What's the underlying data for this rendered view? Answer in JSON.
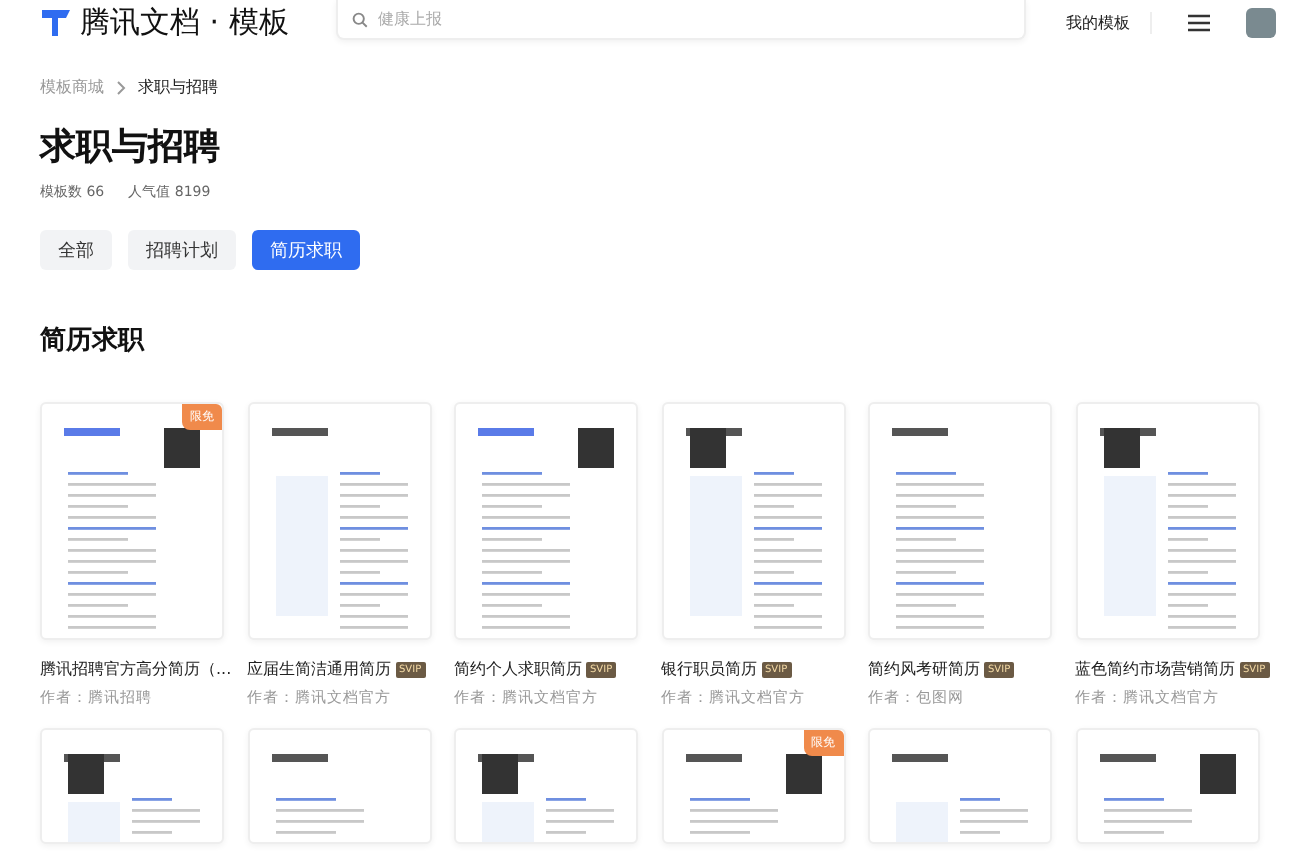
{
  "header": {
    "logo": "腾讯文档 · 模板",
    "search": {
      "placeholder": "健康上报"
    },
    "my_templates": "我的模板"
  },
  "breadcrumb": [
    {
      "label": "模板商城"
    },
    {
      "label": "求职与招聘"
    }
  ],
  "page": {
    "title": "求职与招聘",
    "stats": [
      "模板数 66",
      "人气值 8199"
    ]
  },
  "filters": [
    {
      "label": "全部",
      "selected": false
    },
    {
      "label": "招聘计划",
      "selected": false
    },
    {
      "label": "简历求职",
      "selected": true
    }
  ],
  "section": {
    "title": "简历求职"
  },
  "cards": [
    {
      "title": "腾讯招聘官方高分简历（...",
      "ribbon": "限免",
      "author": "作者：腾讯招聘"
    },
    {
      "title": "应届生简洁通用简历",
      "badge": "SVIP",
      "author": "作者：腾讯文档官方"
    },
    {
      "title": "简约个人求职简历",
      "badge": "SVIP",
      "author": "作者：腾讯文档官方"
    },
    {
      "title": "银行职员简历",
      "badge": "SVIP",
      "author": "作者：腾讯文档官方"
    },
    {
      "title": "简约风考研简历",
      "badge": "SVIP",
      "author": "作者：包图网"
    },
    {
      "title": "蓝色简约市场营销简历",
      "badge": "SVIP",
      "author": "作者：腾讯文档官方"
    }
  ],
  "cards_row_2": [
    {
      "free": false
    },
    {
      "free": false
    },
    {
      "free": false
    },
    {
      "free": true,
      "ribbon": "限免"
    },
    {
      "free": false
    },
    {
      "free": false
    }
  ]
}
